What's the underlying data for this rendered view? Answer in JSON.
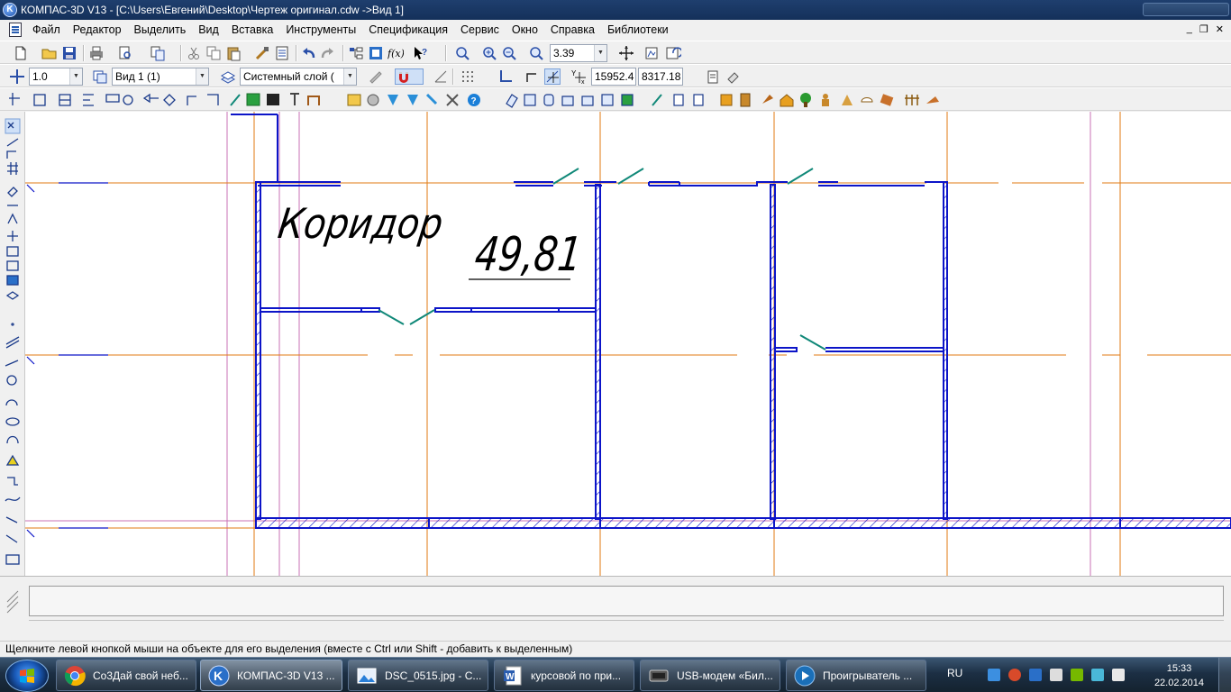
{
  "window": {
    "title": "КОМПАС-3D V13 - [C:\\Users\\Евгений\\Desktop\\Чертеж оригинал.cdw ->Вид 1]"
  },
  "menu": {
    "items": [
      "Файл",
      "Редактор",
      "Выделить",
      "Вид",
      "Вставка",
      "Инструменты",
      "Спецификация",
      "Сервис",
      "Окно",
      "Справка",
      "Библиотеки"
    ]
  },
  "toolbar_top": {
    "zoom_value": "3.39"
  },
  "toolbar_current": {
    "step_value": "1.0",
    "view_value": "Вид 1 (1)",
    "layer_value": "Системный слой (",
    "coord_x": "15952.4",
    "coord_y": "8317.18"
  },
  "drawing": {
    "room_name": "Коридор",
    "room_area": "49,81",
    "colors": {
      "walls": "#0c14c8",
      "axes": "#e07a10",
      "doors": "#108878",
      "aux": "#c870b4"
    }
  },
  "status": {
    "hint": "Щелкните левой кнопкой мыши на объекте для его выделения (вместе с Ctrl или Shift - добавить к выделенным)"
  },
  "taskbar": {
    "tasks": [
      {
        "label": "Со3Дай свой неб...",
        "icon": "chrome-icon"
      },
      {
        "label": "КОМПАС-3D V13 ...",
        "icon": "kompas-icon"
      },
      {
        "label": "DSC_0515.jpg - С...",
        "icon": "image-viewer-icon"
      },
      {
        "label": "курсовой по при...",
        "icon": "word-icon"
      },
      {
        "label": "USB-модем «Бил...",
        "icon": "modem-icon"
      },
      {
        "label": "Проигрыватель ...",
        "icon": "media-player-icon"
      }
    ],
    "language": "RU",
    "time": "15:33",
    "date": "22.02.2014"
  }
}
